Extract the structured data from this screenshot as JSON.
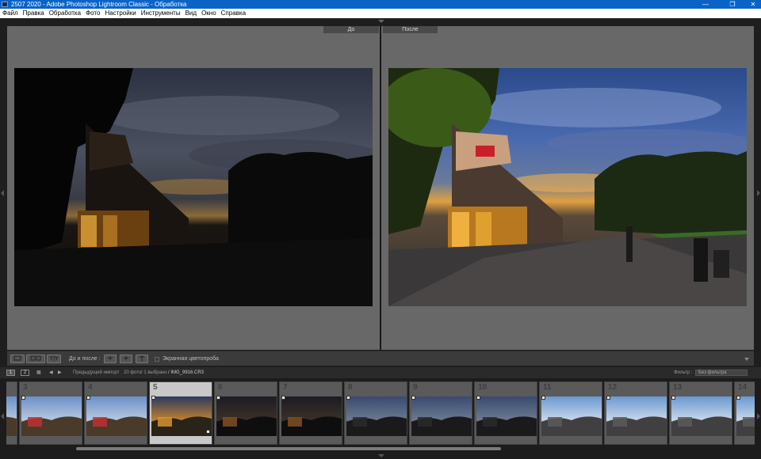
{
  "window": {
    "title": "2507 2020 - Adobe Photoshop Lightroom Classic - Обработка",
    "minimize": "—",
    "maximize": "❐",
    "close": "✕"
  },
  "menu": [
    "Файл",
    "Правка",
    "Обработка",
    "Фото",
    "Настройки",
    "Инструменты",
    "Вид",
    "Окно",
    "Справка"
  ],
  "compare": {
    "before_label": "До",
    "after_label": "После"
  },
  "toolbar": {
    "before_after_label": "До и после :",
    "view_yy": "Y|Y",
    "softproof_label": "Экранная цветопроба"
  },
  "filmstrip_header": {
    "page1": "1",
    "page2": "2",
    "previous_import": "Предыдущий импорт",
    "count": "20 фото",
    "selected": "/ 1 выбрано",
    "filename": "/ IMG_9916.CR3",
    "filter_label": "Фильтр :",
    "filter_value": "Без фильтра"
  },
  "filmstrip": {
    "cells": [
      {
        "index": "",
        "scene": "tent"
      },
      {
        "index": "3",
        "scene": "tent"
      },
      {
        "index": "4",
        "scene": "tent"
      },
      {
        "index": "5",
        "scene": "street-warm",
        "selected": true
      },
      {
        "index": "6",
        "scene": "street-dark"
      },
      {
        "index": "7",
        "scene": "street-dark"
      },
      {
        "index": "8",
        "scene": "dusk"
      },
      {
        "index": "9",
        "scene": "dusk"
      },
      {
        "index": "10",
        "scene": "dusk"
      },
      {
        "index": "11",
        "scene": "sky"
      },
      {
        "index": "12",
        "scene": "sky"
      },
      {
        "index": "13",
        "scene": "sky"
      },
      {
        "index": "14",
        "scene": "sky"
      }
    ]
  },
  "colors": {
    "titlebar": "#0a64c8",
    "workarea": "#686868",
    "selected_cell": "#c8c8c8"
  }
}
